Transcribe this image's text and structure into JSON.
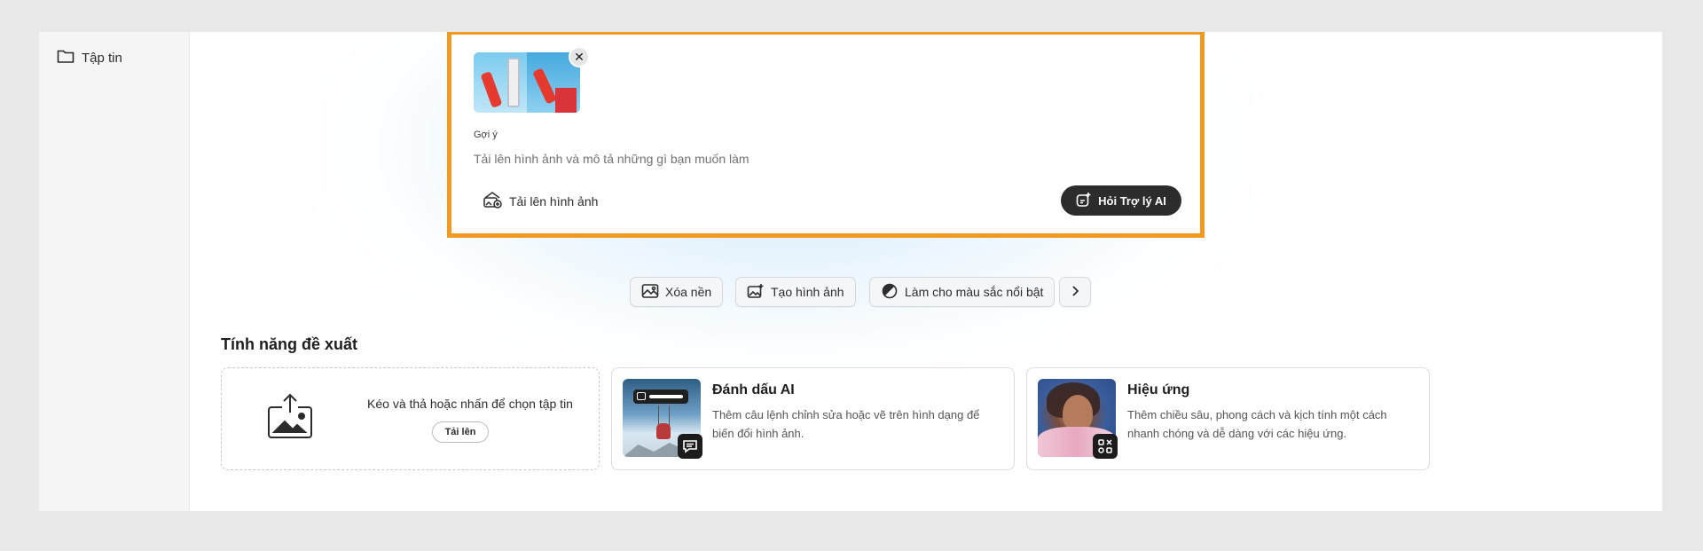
{
  "sidebar": {
    "items": [
      {
        "label": "Tập tin",
        "icon": "folder-icon"
      }
    ]
  },
  "prompt": {
    "label": "Gợi ý",
    "placeholder": "Tải lên hình ảnh và mô tả những gì bạn muốn làm",
    "close_symbol": "✕",
    "upload_label": "Tải lên hình ảnh",
    "ask_ai_label": "Hỏi Trợ lý AI",
    "highlight_color": "#f29a1f"
  },
  "chips": [
    {
      "label": "Xóa nền",
      "icon": "remove-background-icon"
    },
    {
      "label": "Tạo hình ảnh",
      "icon": "generate-image-icon"
    },
    {
      "label": "Làm cho màu sắc nổi bật",
      "icon": "color-contrast-icon"
    },
    {
      "icon": "chevron-right-icon"
    }
  ],
  "section": {
    "title": "Tính năng đề xuất"
  },
  "upload_card": {
    "text": "Kéo và thả hoặc nhấn để chọn tập tin",
    "button": "Tải lên"
  },
  "features": [
    {
      "title": "Đánh dấu AI",
      "description": "Thêm câu lệnh chỉnh sửa hoặc vẽ trên hình dạng để biến đổi hình ảnh.",
      "badge_icon": "chat-bubble-icon"
    },
    {
      "title": "Hiệu ứng",
      "description": "Thêm chiều sâu, phong cách và kịch tính một cách nhanh chóng và dễ dàng với các hiệu ứng.",
      "badge_icon": "effects-grid-icon"
    }
  ]
}
